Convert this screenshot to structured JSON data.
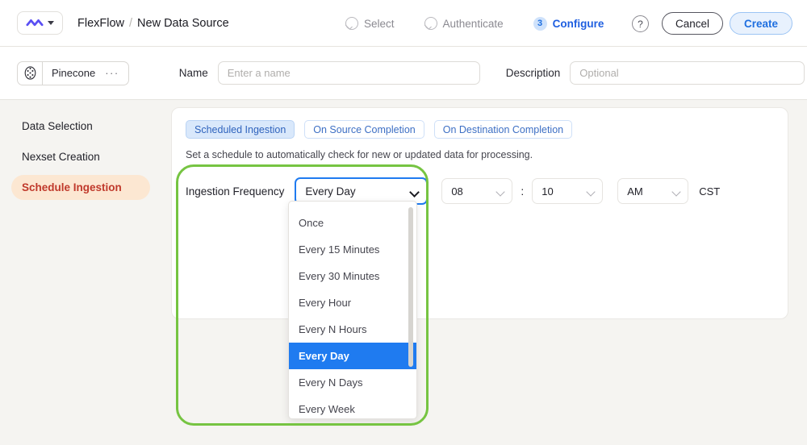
{
  "topbar": {
    "logo_icon": "flexflow-wave-logo",
    "logo_caret_icon": "caret-down-icon",
    "breadcrumb": {
      "app": "FlexFlow",
      "separator": "/",
      "page": "New Data Source"
    },
    "steps": [
      {
        "label": "Select",
        "state": "done",
        "icon": "check-circle-icon"
      },
      {
        "label": "Authenticate",
        "state": "done",
        "icon": "check-circle-icon"
      },
      {
        "label": "Configure",
        "state": "active",
        "number": "3"
      }
    ],
    "help_icon": "question-mark-icon",
    "help_label": "?",
    "cancel_label": "Cancel",
    "create_label": "Create"
  },
  "formbar": {
    "connector": {
      "icon": "pinecone-icon",
      "name": "Pinecone",
      "overflow_icon": "ellipsis-icon",
      "overflow_label": "···"
    },
    "name_label": "Name",
    "name_value": "",
    "name_placeholder": "Enter a name",
    "description_label": "Description",
    "description_value": "",
    "description_placeholder": "Optional"
  },
  "sidebar": {
    "items": [
      {
        "label": "Data Selection",
        "active": false
      },
      {
        "label": "Nexset Creation",
        "active": false
      },
      {
        "label": "Schedule Ingestion",
        "active": true
      }
    ]
  },
  "panel": {
    "tabs": [
      {
        "label": "Scheduled Ingestion",
        "active": true
      },
      {
        "label": "On Source Completion",
        "active": false
      },
      {
        "label": "On Destination Completion",
        "active": false
      }
    ],
    "description": "Set a schedule to automatically check for new or updated data for processing.",
    "frequency_label": "Ingestion Frequency",
    "frequency_value": "Every Day",
    "frequency_caret_icon": "chevron-down-icon",
    "time": {
      "hour_value": "08",
      "hour_caret_icon": "chevron-down-icon",
      "separator": ":",
      "minute_value": "10",
      "minute_caret_icon": "chevron-down-icon",
      "meridiem_value": "AM",
      "meridiem_caret_icon": "chevron-down-icon",
      "timezone": "CST"
    }
  },
  "dropdown": {
    "open": true,
    "selected": "Every Day",
    "options": [
      "Once",
      "Every 15 Minutes",
      "Every 30 Minutes",
      "Every Hour",
      "Every N Hours",
      "Every Day",
      "Every N Days",
      "Every Week"
    ]
  },
  "annotation": {
    "shape": "rounded-rectangle",
    "color": "#76c442"
  },
  "colors": {
    "page_background": "#f5f4f1",
    "panel_background": "#ffffff",
    "accent_blue": "#1f7bf0",
    "active_nav_background": "#fce7d2",
    "active_nav_text": "#c0392b",
    "logo_purple": "#5a4ff3",
    "annotation_green": "#76c442"
  }
}
